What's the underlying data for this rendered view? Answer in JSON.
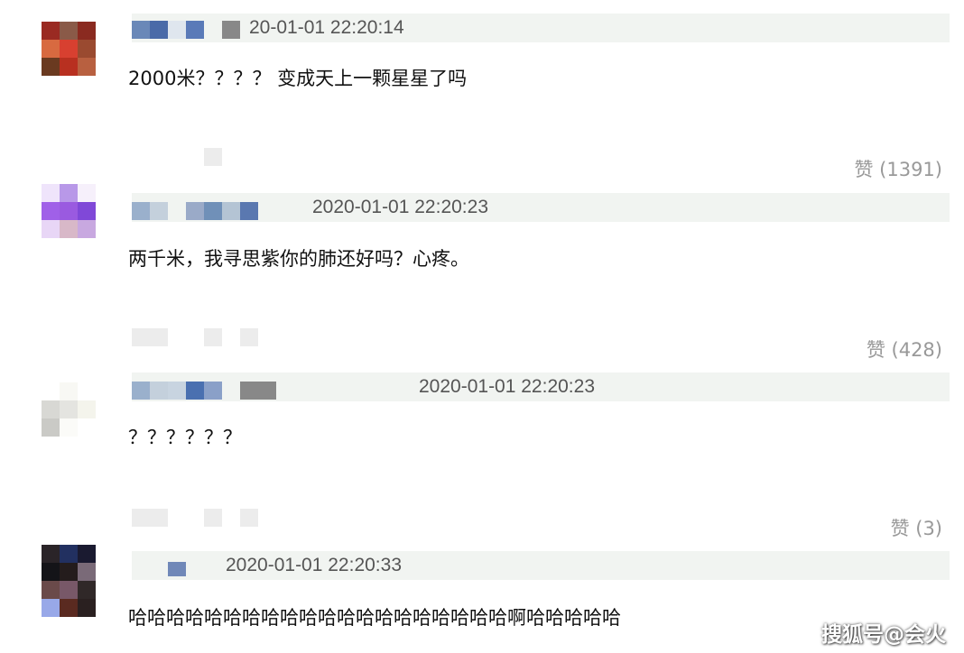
{
  "comments": [
    {
      "time": "20-01-01 22:20:14",
      "text": "2000米？？？？ 变成天上一颗星星了吗",
      "likes": "赞 (1391)",
      "avatar": [
        "#9a2a22",
        "#8a5a48",
        "#8a2a20",
        "#d86a40",
        "#d84030",
        "#9a4a30",
        "#6a3a20",
        "#b83020",
        "#b86040"
      ],
      "name_pixels": [
        "#6a88b8",
        "#4a6aa8",
        "#dfe6ee",
        "#5a7ab8",
        "#f1f4f1",
        "#888888"
      ]
    },
    {
      "time": "2020-01-01 22:20:23",
      "text": "两千米，我寻思紫你的肺还好吗？心疼。",
      "likes": "赞 (428)",
      "avatar": [
        "#efe4fb",
        "#b898e8",
        "#f6f0fb",
        "#a060e8",
        "#9a5ae0",
        "#8048d8",
        "#e8d6f6",
        "#d8b8c8",
        "#c8a8e0"
      ],
      "name_pixels": [
        "#9ab0cc",
        "#c4d0dc",
        "#f1f4f1",
        "#9aaac8",
        "#7090b8",
        "#b4c4d4",
        "#5a78b0"
      ]
    },
    {
      "time": "2020-01-01 22:20:23",
      "text": "？？？？？？",
      "likes": "赞 (3)",
      "avatar": [
        "#ffffff",
        "#f8f8f4",
        "#ffffff",
        "#d8d8d4",
        "#e4e4e0",
        "#f4f4ec",
        "#cacac6",
        "#fbfbf8",
        "#ffffff"
      ],
      "name_pixels": [
        "#9ab0cc",
        "#c4d0dc",
        "#c8d4e0",
        "#4a70b0",
        "#8aa0c8",
        "#f1f4f1",
        "#888888",
        "#888888"
      ]
    },
    {
      "time": "2020-01-01 22:20:33",
      "text": "哈哈哈哈哈哈哈哈哈哈哈哈哈哈哈哈哈哈哈哈啊哈哈哈哈哈",
      "likes": "",
      "avatar": [
        "#2a2428",
        "#223060",
        "#1a1a30",
        "#141418",
        "#241c1c",
        "#7a6a78",
        "#6a4a4a",
        "#785868",
        "#302828",
        "#98a8e8",
        "#5a2a20",
        "#2a2020"
      ],
      "name_pixels": [
        "#7088b8"
      ]
    }
  ],
  "watermark": "搜狐号@会火"
}
